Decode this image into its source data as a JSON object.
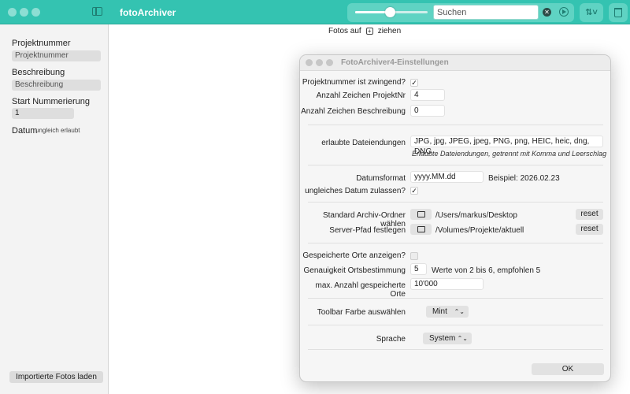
{
  "app": {
    "title": "fotoArchiver"
  },
  "toolbar": {
    "search_placeholder": "Suchen",
    "slider_value": 0.48,
    "clear_glyph": "✕",
    "sort_glyph": "⇅˅",
    "colors": {
      "bar": "#34c3b1",
      "accent": "#5fd3c3"
    }
  },
  "sidebar": {
    "projektnummer_label": "Projektnummer",
    "projektnummer_placeholder": "Projektnummer",
    "beschreibung_label": "Beschreibung",
    "beschreibung_placeholder": "Beschreibung",
    "start_label": "Start Nummerierung",
    "start_value": "1",
    "datum_label": "Datum",
    "datum_note": "ungleich erlaubt",
    "import_button": "Importierte Fotos laden"
  },
  "main": {
    "drop_hint_before": "Fotos auf",
    "drop_hint_after": "ziehen",
    "plus_glyph": "+"
  },
  "dialog": {
    "title": "FotoArchiver4-Einstellungen",
    "projekt_required_label": "Projektnummer ist zwingend?",
    "projekt_required_checked": "✓",
    "zeichen_projekt_label": "Anzahl Zeichen ProjektNr",
    "zeichen_projekt_value": "4",
    "zeichen_beschreibung_label": "Anzahl Zeichen Beschreibung",
    "zeichen_beschreibung_value": "0",
    "endungen_label": "erlaubte Dateiendungen",
    "endungen_value": "JPG, jpg, JPEG, jpeg, PNG, png, HEIC, heic, dng, DNG",
    "endungen_hint": "Erlaubte Dateiendungen, getrennt mit Komma und Leerschlag",
    "datumsformat_label": "Datumsformat",
    "datumsformat_value": "yyyy.MM.dd",
    "datumsformat_example": "Beispiel: 2026.02.23",
    "ungleich_label": "ungleiches Datum zulassen?",
    "ungleich_checked": "✓",
    "archiv_label": "Standard Archiv-Ordner wählen",
    "archiv_path": "/Users/markus/Desktop",
    "server_label": "Server-Pfad festlegen",
    "server_path": "/Volumes/Projekte/aktuell",
    "reset_label": "reset",
    "orte_label": "Gespeicherte Orte anzeigen?",
    "genauigkeit_label": "Genauigkeit Ortsbestimmung",
    "genauigkeit_value": "5",
    "genauigkeit_hint": "Werte von 2 bis 6, empfohlen 5",
    "max_orte_label": "max. Anzahl gespeicherte Orte",
    "max_orte_value": "10'000",
    "farbe_label": "Toolbar Farbe auswählen",
    "farbe_value": "Mint",
    "sprache_label": "Sprache",
    "sprache_value": "System",
    "popup_chevron": "⌃⌄",
    "ok_label": "OK"
  }
}
